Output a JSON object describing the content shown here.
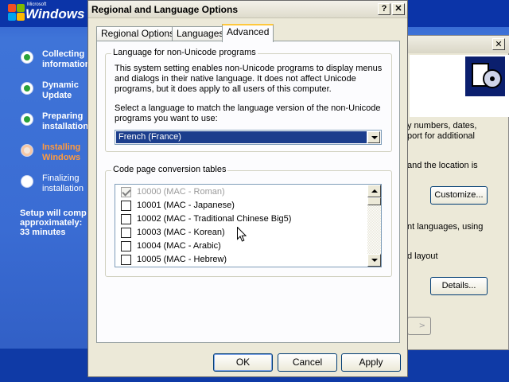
{
  "setup": {
    "logo_small": "Microsoft",
    "logo_text": "Windows",
    "steps": [
      {
        "label": "Collecting\ninformation",
        "state": "done"
      },
      {
        "label": "Dynamic\nUpdate",
        "state": "done"
      },
      {
        "label": "Preparing\ninstallation",
        "state": "done"
      },
      {
        "label": "Installing\nWindows",
        "state": "current"
      },
      {
        "label": "Finalizing\ninstallation",
        "state": "pending"
      }
    ],
    "eta": "Setup will comp\napproximately:\n33 minutes"
  },
  "background_dialog": {
    "close_glyph": "✕",
    "text_1": "y numbers, dates,\nport for additional",
    "text_2": "and the location is",
    "button_customize": "Customize...",
    "text_3": "nt languages, using",
    "text_4": "d layout",
    "button_details": "Details..."
  },
  "dialog": {
    "title": "Regional and Language Options",
    "help_glyph": "?",
    "close_glyph": "✕",
    "tabs": [
      {
        "label": "Regional Options",
        "active": false
      },
      {
        "label": "Languages",
        "active": false
      },
      {
        "label": "Advanced",
        "active": true
      }
    ],
    "nonunicode": {
      "group_label": "Language for non-Unicode programs",
      "description": "This system setting enables non-Unicode programs to display menus\nand dialogs in their native language. It does not affect Unicode\nprograms, but it does apply to all users of this computer.",
      "instruction": "Select a language to match the language version of the non-Unicode\nprograms you want to use:",
      "selected_language": "French (France)"
    },
    "codepages": {
      "group_label": "Code page conversion tables",
      "items": [
        {
          "label": "10000 (MAC - Roman)",
          "checked": true,
          "disabled": true
        },
        {
          "label": "10001 (MAC - Japanese)",
          "checked": false,
          "disabled": false
        },
        {
          "label": "10002 (MAC - Traditional Chinese Big5)",
          "checked": false,
          "disabled": false
        },
        {
          "label": "10003 (MAC - Korean)",
          "checked": false,
          "disabled": false
        },
        {
          "label": "10004 (MAC - Arabic)",
          "checked": false,
          "disabled": false
        },
        {
          "label": "10005 (MAC - Hebrew)",
          "checked": false,
          "disabled": false
        }
      ]
    },
    "buttons": {
      "ok": "OK",
      "cancel": "Cancel",
      "apply": "Apply"
    }
  }
}
